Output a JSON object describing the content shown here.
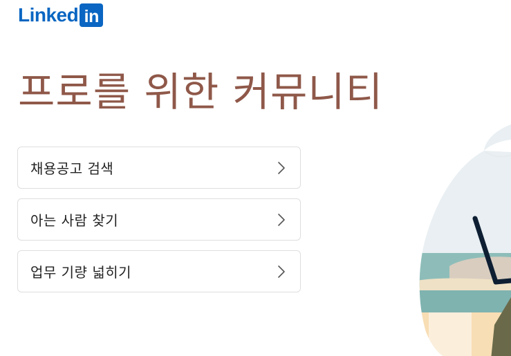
{
  "brand": {
    "logo_word": "Linked",
    "logo_box": "in",
    "color": "#0a66c2"
  },
  "hero": {
    "headline": "프로를 위한 커뮤니티",
    "headline_color": "#8f5849"
  },
  "actions": [
    {
      "label": "채용공고 검색",
      "icon": "chevron-right-icon"
    },
    {
      "label": "아는 사람 찾기",
      "icon": "chevron-right-icon"
    },
    {
      "label": "업무 기량 넓히기",
      "icon": "chevron-right-icon"
    }
  ],
  "illustration": {
    "icon": "hero-illustration"
  }
}
